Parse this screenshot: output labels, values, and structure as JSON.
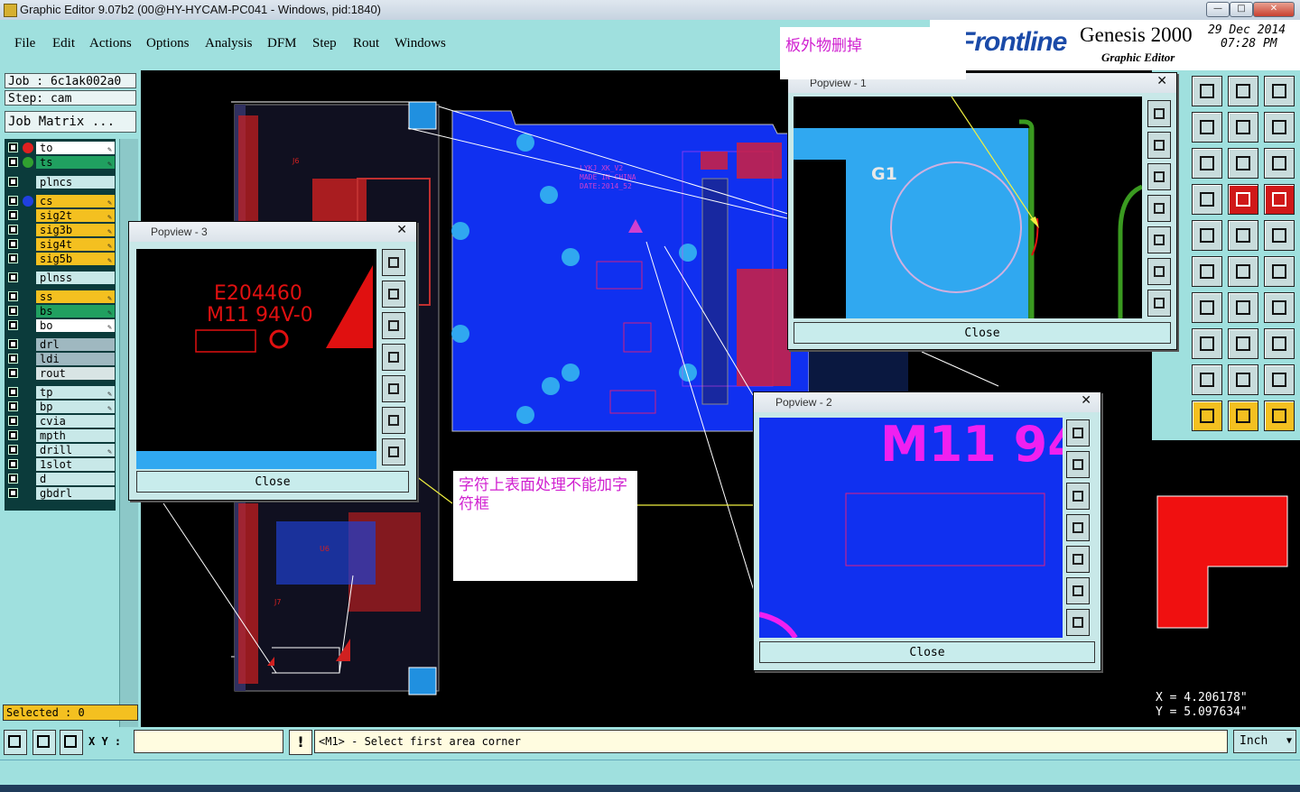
{
  "window": {
    "title": "Graphic Editor 9.07b2 (00@HY-HYCAM-PC041 - Windows, pid:1840)",
    "min_label": "—",
    "max_label": "□",
    "close_label": "✕"
  },
  "menu": [
    "File",
    "Edit",
    "Actions",
    "Options",
    "Analysis",
    "DFM",
    "Step",
    "Rout",
    "Windows"
  ],
  "logo": {
    "brand": "Frontline",
    "product": "Genesis 2000",
    "subtitle": "Graphic Editor",
    "date": "29 Dec 2014",
    "time": "07:28 PM"
  },
  "job": {
    "job_label": "Job : 6c1ak002a0",
    "step_label": "Step: cam",
    "matrix_label": "Job Matrix ..."
  },
  "layers": [
    {
      "name": "to",
      "color": "#ffffff",
      "dot": "#e02020",
      "edit": true
    },
    {
      "name": "ts",
      "color": "#20a060",
      "dot": "#30a030",
      "edit": true
    },
    {
      "name": "plncs",
      "color": "#c8e8e8",
      "dot": "",
      "edit": false
    },
    {
      "name": "cs",
      "color": "#f4c020",
      "dot": "#2040e0",
      "edit": true
    },
    {
      "name": "sig2t",
      "color": "#f4c020",
      "dot": "",
      "edit": true
    },
    {
      "name": "sig3b",
      "color": "#f4c020",
      "dot": "",
      "edit": true
    },
    {
      "name": "sig4t",
      "color": "#f4c020",
      "dot": "",
      "edit": true
    },
    {
      "name": "sig5b",
      "color": "#f4c020",
      "dot": "",
      "edit": true
    },
    {
      "name": "plnss",
      "color": "#c8e8e8",
      "dot": "",
      "edit": false
    },
    {
      "name": "ss",
      "color": "#f4c020",
      "dot": "",
      "edit": true
    },
    {
      "name": "bs",
      "color": "#20a060",
      "dot": "",
      "edit": true
    },
    {
      "name": "bo",
      "color": "#ffffff",
      "dot": "",
      "edit": true
    },
    {
      "name": "drl",
      "color": "#9fb8c0",
      "dot": "",
      "edit": false
    },
    {
      "name": "ldi",
      "color": "#9fb8c0",
      "dot": "",
      "edit": false
    },
    {
      "name": "rout",
      "color": "#d8e4e4",
      "dot": "",
      "edit": false
    },
    {
      "name": "tp",
      "color": "#c8e8e8",
      "dot": "",
      "edit": true
    },
    {
      "name": "bp",
      "color": "#c8e8e8",
      "dot": "",
      "edit": true
    },
    {
      "name": "cvia",
      "color": "#c8e8e8",
      "dot": "",
      "edit": false
    },
    {
      "name": "mpth",
      "color": "#c8e8e8",
      "dot": "",
      "edit": false
    },
    {
      "name": "drill",
      "color": "#c8e8e8",
      "dot": "",
      "edit": true
    },
    {
      "name": "1slot",
      "color": "#c8e8e8",
      "dot": "",
      "edit": false
    },
    {
      "name": "d",
      "color": "#c8e8e8",
      "dot": "",
      "edit": false
    },
    {
      "name": "gbdrl",
      "color": "#c8e8e8",
      "dot": "",
      "edit": false
    }
  ],
  "selected_label": "Selected : 0",
  "status": {
    "xy_label": "X Y :",
    "xy_value": "",
    "prompt": "<M1> - Select first area corner",
    "units": "Inch"
  },
  "coords": {
    "x": "X = 4.206178\"",
    "y": "Y = 5.097634\""
  },
  "board": {
    "text1": "LYKJ_XK_V2",
    "text2": "MADE IN CHINA",
    "text3": "DATE:2014_52",
    "ref_j1": "J1",
    "ref_j6": "J6",
    "ref_j7": "J7",
    "ref_u6": "U6",
    "ref_g1": "G1"
  },
  "popviews": {
    "p1": {
      "title": "Popview - 1",
      "close": "Close",
      "label": "G1"
    },
    "p2": {
      "title": "Popview - 2",
      "close": "Close",
      "label": "M11 94"
    },
    "p3": {
      "title": "Popview - 3",
      "close": "Close",
      "line1": "E204460",
      "line2": "M11 94V-0"
    }
  },
  "notes": {
    "top": "板外物删掉",
    "middle": "字符上表面处理不能加字符框"
  }
}
